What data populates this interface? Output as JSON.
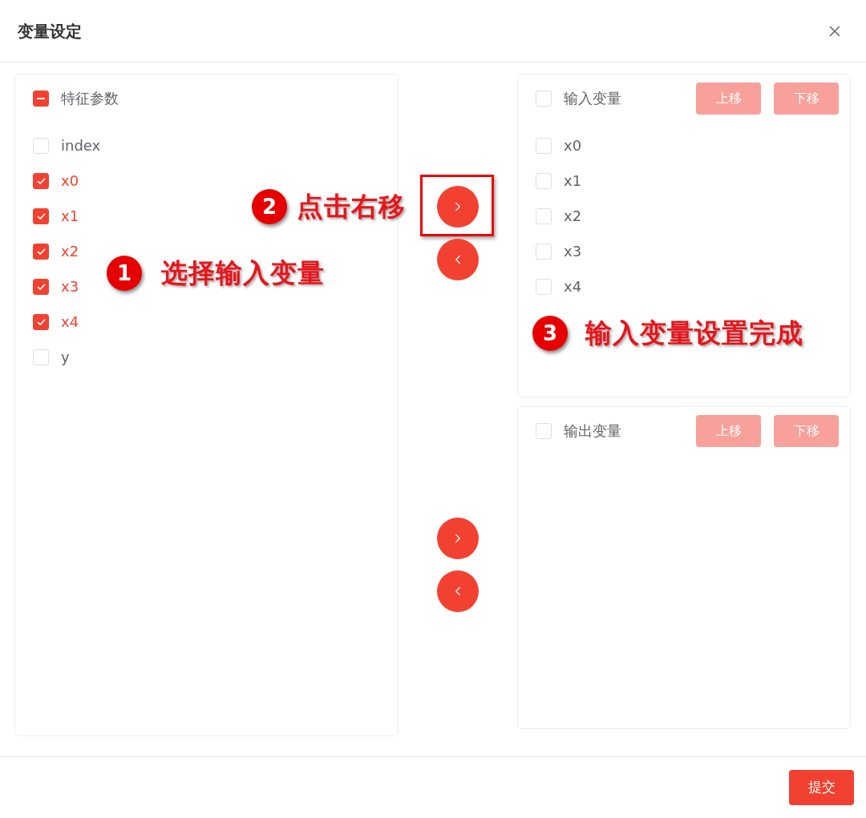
{
  "dialog": {
    "title": "变量设定"
  },
  "source_list": {
    "header": {
      "label": "特征参数",
      "indeterminate": true
    },
    "items": [
      {
        "label": "index",
        "checked": false
      },
      {
        "label": "x0",
        "checked": true
      },
      {
        "label": "x1",
        "checked": true
      },
      {
        "label": "x2",
        "checked": true
      },
      {
        "label": "x3",
        "checked": true
      },
      {
        "label": "x4",
        "checked": true
      },
      {
        "label": "y",
        "checked": false
      }
    ]
  },
  "transfer_groups": [
    {
      "buttons": [
        {
          "kind": "right",
          "highlighted": true
        },
        {
          "kind": "left",
          "highlighted": false
        }
      ]
    },
    {
      "buttons": [
        {
          "kind": "right",
          "highlighted": false
        },
        {
          "kind": "left",
          "highlighted": false
        }
      ]
    }
  ],
  "target_lists": [
    {
      "header": {
        "label": "输入变量",
        "checked": false
      },
      "buttons": [
        {
          "label": "上移",
          "disabled": true
        },
        {
          "label": "下移",
          "disabled": true
        }
      ],
      "items": [
        {
          "label": "x0",
          "checked": false
        },
        {
          "label": "x1",
          "checked": false
        },
        {
          "label": "x2",
          "checked": false
        },
        {
          "label": "x3",
          "checked": false
        },
        {
          "label": "x4",
          "checked": false
        }
      ]
    },
    {
      "header": {
        "label": "输出变量",
        "checked": false
      },
      "buttons": [
        {
          "label": "上移",
          "disabled": true
        },
        {
          "label": "下移",
          "disabled": true
        }
      ]
    }
  ],
  "footer": {
    "submit": {
      "label": "提交"
    }
  },
  "annotations": [
    {
      "number": "1",
      "text": "选择输入变量"
    },
    {
      "number": "2",
      "text": "点击右移"
    },
    {
      "number": "3",
      "text": "输入变量设置完成"
    }
  ]
}
